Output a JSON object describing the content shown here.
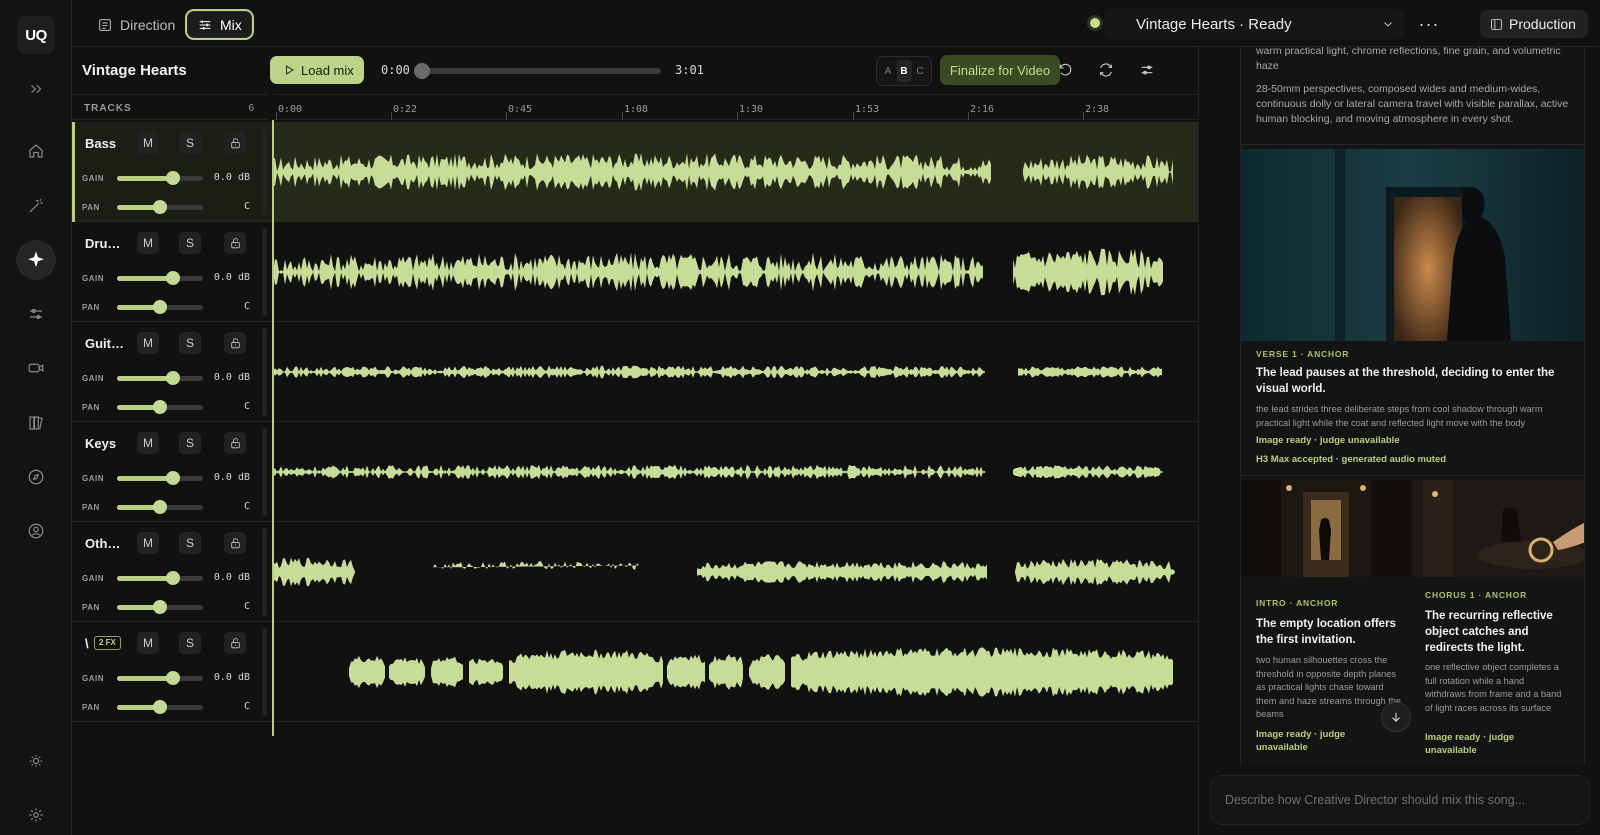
{
  "app": {
    "logo": "UQ"
  },
  "rail": {
    "items": [
      {
        "name": "expand-icon"
      },
      {
        "name": "home-icon"
      },
      {
        "name": "magic-wand-icon"
      },
      {
        "name": "sparkle-icon",
        "active": true
      },
      {
        "name": "sliders-icon"
      },
      {
        "name": "video-icon"
      },
      {
        "name": "library-icon"
      },
      {
        "name": "compass-icon"
      },
      {
        "name": "user-icon"
      }
    ],
    "bottom": [
      {
        "name": "sun-icon"
      },
      {
        "name": "gear-icon"
      }
    ]
  },
  "header": {
    "tabs": [
      {
        "label": "Direction"
      },
      {
        "label": "Mix",
        "active": true
      }
    ],
    "project": "Vintage Hearts · Ready",
    "more": "···",
    "production_label": "Production"
  },
  "mix": {
    "title": "Vintage Hearts",
    "load_label": "Load mix",
    "time_current": "0:00",
    "time_total": "3:01",
    "position_fraction": 0,
    "ab": [
      "A",
      "B",
      "C"
    ],
    "ab_selected": "B",
    "finalize_label": "Finalize for Video"
  },
  "timeline": {
    "tracks_label": "TRACKS",
    "tracks_count": "6",
    "ticks": [
      "0:00",
      "0:22",
      "0:45",
      "1:08",
      "1:30",
      "1:53",
      "2:16",
      "2:38"
    ]
  },
  "tracks": [
    {
      "name": "Bass",
      "badge": "",
      "mute": "M",
      "solo": "S",
      "gain_label": "GAIN",
      "gain_value": "0.0 dB",
      "gain_level": 0.65,
      "pan_label": "PAN",
      "pan_value": "C",
      "pan_level": 0.5,
      "selected": true
    },
    {
      "name": "Dru…",
      "badge": "",
      "mute": "M",
      "solo": "S",
      "gain_label": "GAIN",
      "gain_value": "0.0 dB",
      "gain_level": 0.65,
      "pan_label": "PAN",
      "pan_value": "C",
      "pan_level": 0.5
    },
    {
      "name": "Guit…",
      "badge": "",
      "mute": "M",
      "solo": "S",
      "gain_label": "GAIN",
      "gain_value": "0.0 dB",
      "gain_level": 0.65,
      "pan_label": "PAN",
      "pan_value": "C",
      "pan_level": 0.5
    },
    {
      "name": "Keys",
      "badge": "",
      "mute": "M",
      "solo": "S",
      "gain_label": "GAIN",
      "gain_value": "0.0 dB",
      "gain_level": 0.65,
      "pan_label": "PAN",
      "pan_value": "C",
      "pan_level": 0.5
    },
    {
      "name": "Oth…",
      "badge": "",
      "mute": "M",
      "solo": "S",
      "gain_label": "GAIN",
      "gain_value": "0.0 dB",
      "gain_level": 0.65,
      "pan_label": "PAN",
      "pan_value": "C",
      "pan_level": 0.5
    },
    {
      "name": "\\",
      "badge": "2 FX",
      "mute": "M",
      "solo": "S",
      "gain_label": "GAIN",
      "gain_value": "0.0 dB",
      "gain_level": 0.65,
      "pan_label": "PAN",
      "pan_value": "C",
      "pan_level": 0.5
    }
  ],
  "panel": {
    "intro_text": "warm practical light, chrome reflections, fine grain, and volumetric haze",
    "lens_text": "28-50mm perspectives, composed wides and medium-wides, continuous dolly or lateral camera travel with visible parallax, active human blocking, and moving atmosphere in every shot.",
    "verse": {
      "tag": "VERSE 1 · ANCHOR",
      "heading": "The lead pauses at the threshold, deciding to enter the visual world.",
      "body": "the lead strides three deliberate steps from cool shadow through warm practical light while the coat and reflected light move with the body",
      "status1": "Image ready · judge unavailable",
      "status2": "H3 Max accepted · generated audio muted"
    },
    "intro_card": {
      "tag": "INTRO · ANCHOR",
      "heading": "The empty location offers the first invitation.",
      "body": "two human silhouettes cross the threshold in opposite depth planes as practical lights chase toward them and haze streams through the beams",
      "status": "Image ready · judge unavailable"
    },
    "chorus_card": {
      "tag": "CHORUS 1 · ANCHOR",
      "heading": "The recurring reflective object catches and redirects the light.",
      "body": "one reflective object completes a full rotation while a hand withdraws from frame and a band of light races across its surface",
      "status": "Image ready · judge unavailable"
    }
  },
  "prompt": {
    "placeholder": "Describe how Creative Director should mix this song..."
  },
  "colors": {
    "accent": "#b9cf86",
    "wave": "#c6dc97",
    "bg": "#111111"
  }
}
